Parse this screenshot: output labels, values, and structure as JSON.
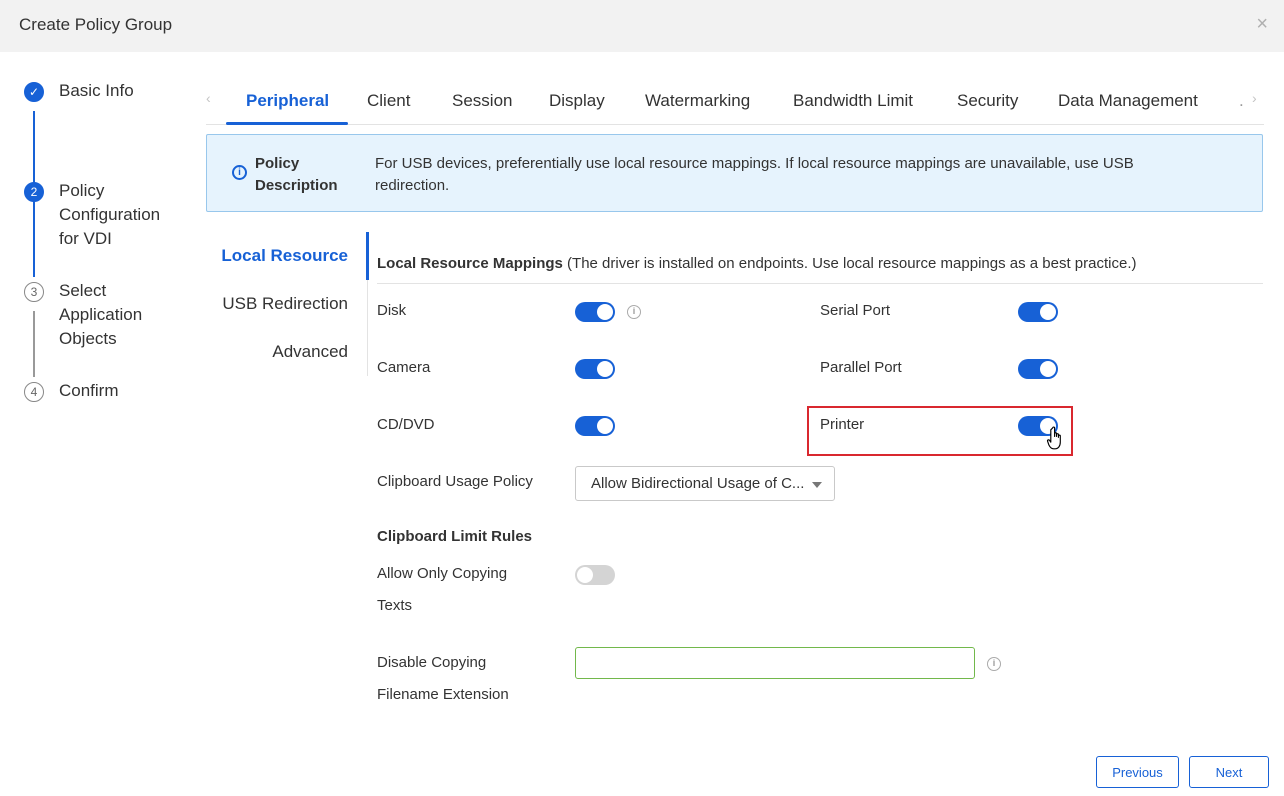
{
  "dialog": {
    "title": "Create Policy Group",
    "close_glyph": "×"
  },
  "steps": [
    {
      "number": "✓",
      "label": "Basic Info",
      "state": "done"
    },
    {
      "number": "2",
      "label": "Policy Configuration for VDI",
      "state": "active"
    },
    {
      "number": "3",
      "label": "Select Application Objects",
      "state": "todo"
    },
    {
      "number": "4",
      "label": "Confirm",
      "state": "todo"
    }
  ],
  "tabs": {
    "prev_arrow": "‹",
    "next_arrow": "›",
    "overflow": ".",
    "items": [
      {
        "label": "Peripheral",
        "active": true
      },
      {
        "label": "Client"
      },
      {
        "label": "Session"
      },
      {
        "label": "Display"
      },
      {
        "label": "Watermarking"
      },
      {
        "label": "Bandwidth Limit"
      },
      {
        "label": "Security"
      },
      {
        "label": "Data Management"
      }
    ]
  },
  "description": {
    "label": "Policy Description",
    "text": "For USB devices, preferentially use local resource mappings. If local resource mappings are unavailable, use USB redirection."
  },
  "sidenav": {
    "items": [
      {
        "label": "Local Resource",
        "active": true
      },
      {
        "label": "USB Redirection"
      },
      {
        "label": "Advanced"
      }
    ]
  },
  "form": {
    "section_title": "Local Resource Mappings",
    "section_note": " (The driver is installed on endpoints. Use local resource mappings as a best practice.)",
    "toggles": [
      {
        "label": "Disk",
        "on": true,
        "help": true
      },
      {
        "label": "Serial Port",
        "on": true
      },
      {
        "label": "Camera",
        "on": true
      },
      {
        "label": "Parallel Port",
        "on": true
      },
      {
        "label": "CD/DVD",
        "on": true
      },
      {
        "label": "Printer",
        "on": true
      }
    ],
    "clipboard_policy_label": "Clipboard Usage Policy",
    "clipboard_policy_value": "Allow Bidirectional Usage of C...",
    "clipboard_rules_title": "Clipboard Limit Rules",
    "allow_copy_label_1": "Allow Only Copying",
    "allow_copy_label_2": "Texts",
    "allow_copy_on": false,
    "disable_ext_label_1": "Disable Copying",
    "disable_ext_label_2": "Filename Extension",
    "disable_ext_value": ""
  },
  "footer": {
    "previous_label": "Previous",
    "next_label": "Next"
  },
  "colors": {
    "accent": "#1761d6",
    "highlight": "#d9282f",
    "info_bg": "#e6f3fd"
  }
}
